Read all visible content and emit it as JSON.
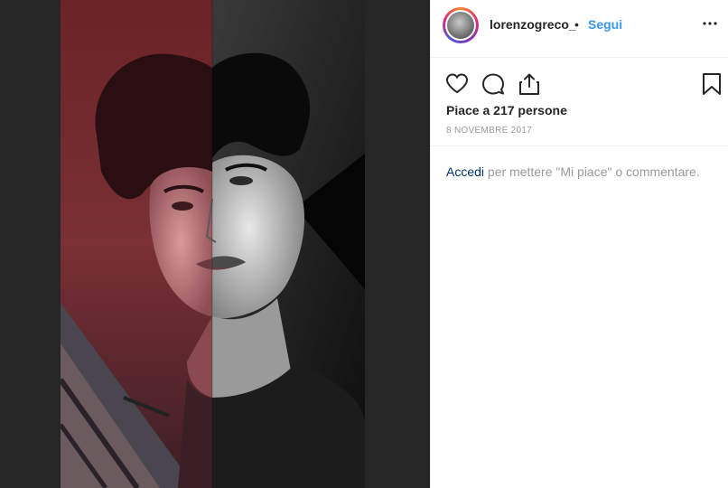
{
  "post": {
    "username": "lorenzogreco_",
    "separator": "•",
    "follow_label": "Segui",
    "likes_text": "Piace a 217 persone",
    "date": "8 NOVEMBRE 2017",
    "login_link": "Accedi",
    "login_rest": " per mettere \"Mi piace\" o commentare."
  },
  "icons": {
    "more": "more-options-icon",
    "like": "heart-icon",
    "comment": "comment-bubble-icon",
    "share": "share-upload-icon",
    "save": "bookmark-icon"
  },
  "colors": {
    "follow": "#3897f0",
    "link": "#003569",
    "muted": "#999999",
    "media_bg": "#262626"
  }
}
